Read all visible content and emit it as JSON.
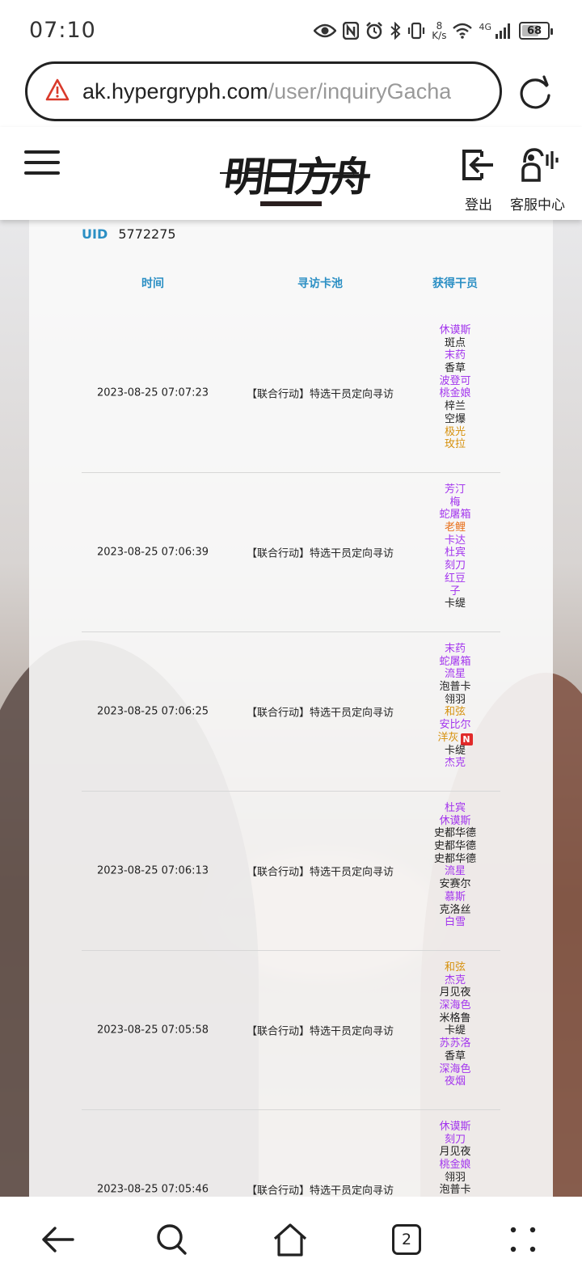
{
  "status_bar": {
    "time": "07:10",
    "net_speed_value": "8",
    "net_speed_unit": "K/s",
    "network_type": "4G",
    "battery": "68",
    "battery_level_percent": 68,
    "icons": [
      "eye-icon",
      "nfc-icon",
      "alarm-icon",
      "bluetooth-icon",
      "vibrate-icon",
      "wifi-icon",
      "signal-icon",
      "battery-icon"
    ]
  },
  "browser": {
    "url_host": "ak.hypergryph.com",
    "url_path": "/user/inquiryGacha",
    "warning_color": "#d93a2b"
  },
  "header": {
    "logo_text": "明日方舟",
    "logout_label": "登出",
    "service_label": "客服中心"
  },
  "uid": {
    "label": "UID",
    "value": "5772275"
  },
  "table": {
    "headers": {
      "time": "时间",
      "pool": "寻访卡池",
      "operators": "获得干员"
    },
    "header_color": "#2b8fc4",
    "rarity_colors": {
      "r3": "#222222",
      "r4": "#a335ee",
      "r5": "#d6900b",
      "r6": "#e8701a"
    },
    "rows": [
      {
        "time": "2023-08-25 07:07:23",
        "pool": "【联合行动】特选干员定向寻访",
        "ops": [
          {
            "name": "休谟斯",
            "rarity": 4
          },
          {
            "name": "斑点",
            "rarity": 3
          },
          {
            "name": "末药",
            "rarity": 4
          },
          {
            "name": "香草",
            "rarity": 3
          },
          {
            "name": "波登可",
            "rarity": 4
          },
          {
            "name": "桃金娘",
            "rarity": 4
          },
          {
            "name": "梓兰",
            "rarity": 3
          },
          {
            "name": "空爆",
            "rarity": 3
          },
          {
            "name": "极光",
            "rarity": 5
          },
          {
            "name": "玫拉",
            "rarity": 5
          }
        ]
      },
      {
        "time": "2023-08-25 07:06:39",
        "pool": "【联合行动】特选干员定向寻访",
        "ops": [
          {
            "name": "芳汀",
            "rarity": 4
          },
          {
            "name": "梅",
            "rarity": 4
          },
          {
            "name": "蛇屠箱",
            "rarity": 4
          },
          {
            "name": "老鲤",
            "rarity": 6
          },
          {
            "name": "卡达",
            "rarity": 4
          },
          {
            "name": "杜宾",
            "rarity": 4
          },
          {
            "name": "刻刀",
            "rarity": 4
          },
          {
            "name": "红豆",
            "rarity": 4
          },
          {
            "name": "子",
            "rarity": 4
          },
          {
            "name": "卡缇",
            "rarity": 3
          }
        ]
      },
      {
        "time": "2023-08-25 07:06:25",
        "pool": "【联合行动】特选干员定向寻访",
        "ops": [
          {
            "name": "末药",
            "rarity": 4
          },
          {
            "name": "蛇屠箱",
            "rarity": 4
          },
          {
            "name": "流星",
            "rarity": 4
          },
          {
            "name": "泡普卡",
            "rarity": 3
          },
          {
            "name": "翎羽",
            "rarity": 3
          },
          {
            "name": "和弦",
            "rarity": 5
          },
          {
            "name": "安比尔",
            "rarity": 4
          },
          {
            "name": "洋灰",
            "rarity": 5,
            "new": "N"
          },
          {
            "name": "卡缇",
            "rarity": 3
          },
          {
            "name": "杰克",
            "rarity": 4
          }
        ]
      },
      {
        "time": "2023-08-25 07:06:13",
        "pool": "【联合行动】特选干员定向寻访",
        "ops": [
          {
            "name": "杜宾",
            "rarity": 4
          },
          {
            "name": "休谟斯",
            "rarity": 4
          },
          {
            "name": "史都华德",
            "rarity": 3
          },
          {
            "name": "史都华德",
            "rarity": 3
          },
          {
            "name": "史都华德",
            "rarity": 3
          },
          {
            "name": "流星",
            "rarity": 4
          },
          {
            "name": "安赛尔",
            "rarity": 3
          },
          {
            "name": "慕斯",
            "rarity": 4
          },
          {
            "name": "克洛丝",
            "rarity": 3
          },
          {
            "name": "白雪",
            "rarity": 4
          }
        ]
      },
      {
        "time": "2023-08-25 07:05:58",
        "pool": "【联合行动】特选干员定向寻访",
        "ops": [
          {
            "name": "和弦",
            "rarity": 5
          },
          {
            "name": "杰克",
            "rarity": 4
          },
          {
            "name": "月见夜",
            "rarity": 3
          },
          {
            "name": "深海色",
            "rarity": 4
          },
          {
            "name": "米格鲁",
            "rarity": 3
          },
          {
            "name": "卡缇",
            "rarity": 3
          },
          {
            "name": "苏苏洛",
            "rarity": 4
          },
          {
            "name": "香草",
            "rarity": 3
          },
          {
            "name": "深海色",
            "rarity": 4
          },
          {
            "name": "夜烟",
            "rarity": 4
          }
        ]
      },
      {
        "time": "2023-08-25 07:05:46",
        "pool": "【联合行动】特选干员定向寻访",
        "ops": [
          {
            "name": "休谟斯",
            "rarity": 4
          },
          {
            "name": "刻刀",
            "rarity": 4
          },
          {
            "name": "月见夜",
            "rarity": 3
          },
          {
            "name": "桃金娘",
            "rarity": 4
          },
          {
            "name": "翎羽",
            "rarity": 3
          },
          {
            "name": "泡普卡",
            "rarity": 3
          }
        ]
      }
    ]
  },
  "bottom_nav": {
    "tab_count": "2",
    "icons": [
      "back-icon",
      "search-icon",
      "home-icon",
      "tabs-icon",
      "more-icon"
    ]
  }
}
